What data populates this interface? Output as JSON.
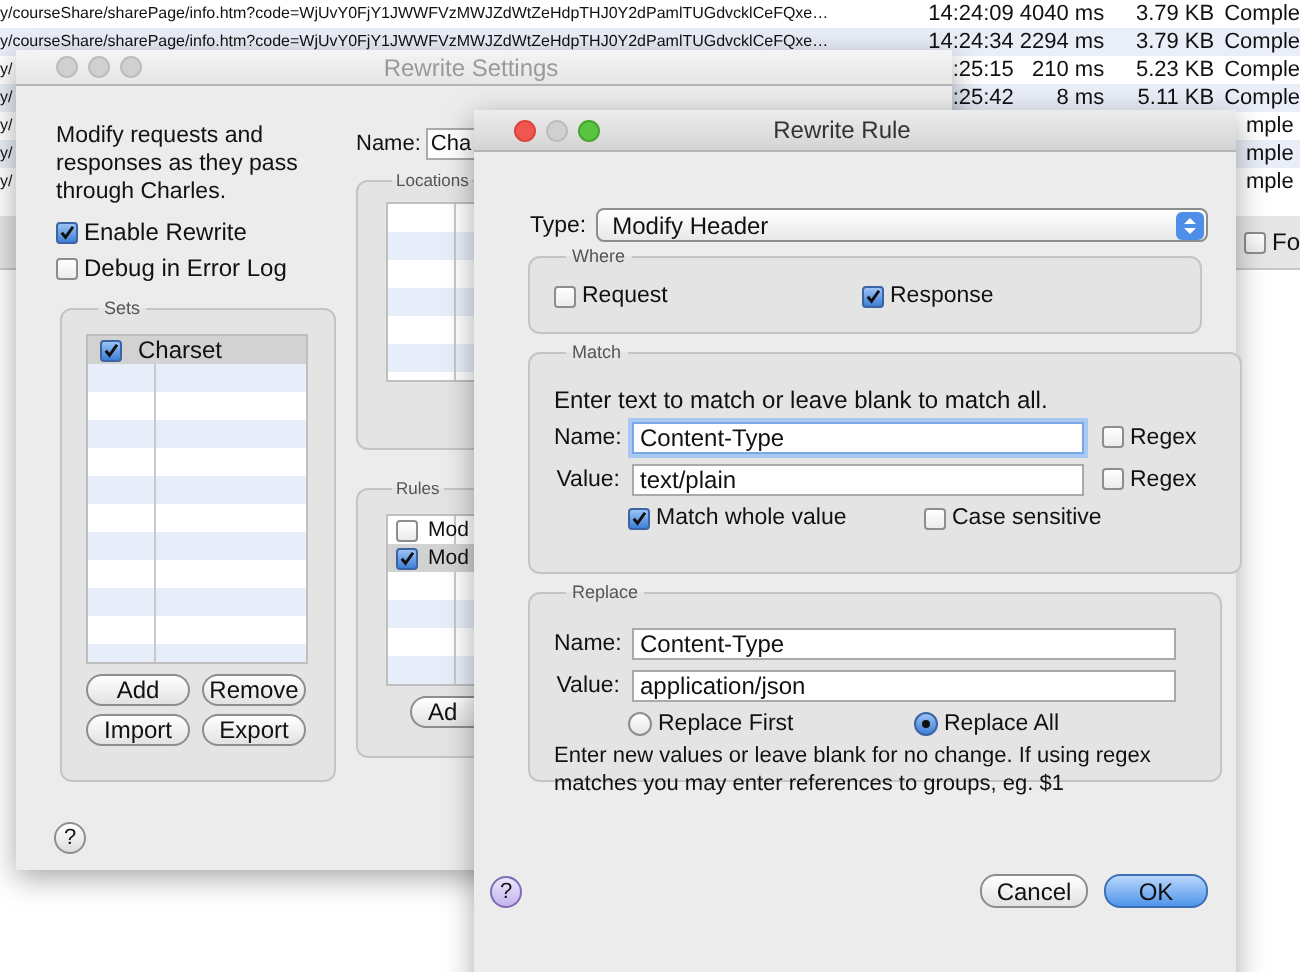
{
  "background_table": {
    "rows": [
      {
        "url": "y/courseShare/sharePage/info.htm?code=WjUvY0FjY1JWWFVzMWJZdWtZeHdpTHJ0Y2dPamlTUGdvcklCeFQxe…",
        "time": "14:24:09",
        "duration": "4040 ms",
        "size": "3.79 KB",
        "status": "Comple"
      },
      {
        "url": "y/courseShare/sharePage/info.htm?code=WjUvY0FjY1JWWFVzMWJZdWtZeHdpTHJ0Y2dPamlTUGdvcklCeFQxe…",
        "time": "14:24:34",
        "duration": "2294 ms",
        "size": "3.79 KB",
        "status": "Comple"
      },
      {
        "url": "y/",
        "time": ":25:15",
        "duration": "210 ms",
        "size": "5.23 KB",
        "status": "Comple"
      },
      {
        "url": "y/",
        "time": ":25:42",
        "duration": "8 ms",
        "size": "5.11 KB",
        "status": "Comple"
      },
      {
        "url": "y/",
        "status": "mple"
      },
      {
        "url": "y/",
        "status": "mple"
      },
      {
        "url": "y/",
        "status": "mple"
      }
    ]
  },
  "filter_checkbox": {
    "label": "Fo",
    "checked": false
  },
  "rewrite_settings": {
    "title": "Rewrite Settings",
    "description": "Modify requests and responses as they pass through Charles.",
    "enable_rewrite": {
      "label": "Enable Rewrite",
      "checked": true
    },
    "debug_log": {
      "label": "Debug in Error Log",
      "checked": false
    },
    "sets": {
      "title": "Sets",
      "items": [
        {
          "label": "Charset",
          "checked": true,
          "selected": true
        }
      ],
      "buttons": [
        "Add",
        "Remove",
        "Import",
        "Export"
      ]
    },
    "name_label": "Name:",
    "name_value": "Cha",
    "locations": {
      "title": "Locations"
    },
    "rules": {
      "title": "Rules",
      "items": [
        {
          "label": "Mod",
          "checked": false,
          "selected": false
        },
        {
          "label": "Mod",
          "checked": true,
          "selected": true
        }
      ],
      "buttons": [
        "Ad"
      ]
    },
    "help": "?"
  },
  "rewrite_rule": {
    "title": "Rewrite Rule",
    "type_label": "Type:",
    "type_value": "Modify Header",
    "where": {
      "title": "Where",
      "options": [
        {
          "label": "Request",
          "checked": false
        },
        {
          "label": "Response",
          "checked": true
        }
      ]
    },
    "match": {
      "title": "Match",
      "hint": "Enter text to match or leave blank to match all.",
      "fields": [
        {
          "label": "Name:",
          "value": "Content-Type",
          "focused": true,
          "regex": {
            "label": "Regex",
            "checked": false
          }
        },
        {
          "label": "Value:",
          "value": "text/plain",
          "focused": false,
          "regex": {
            "label": "Regex",
            "checked": false
          }
        }
      ],
      "options": [
        {
          "label": "Match whole value",
          "checked": true
        },
        {
          "label": "Case sensitive",
          "checked": false
        }
      ]
    },
    "replace": {
      "title": "Replace",
      "fields": [
        {
          "label": "Name:",
          "value": "Content-Type"
        },
        {
          "label": "Value:",
          "value": "application/json"
        }
      ],
      "options": [
        {
          "label": "Replace First",
          "selected": false
        },
        {
          "label": "Replace All",
          "selected": true
        }
      ],
      "note": "Enter new values or leave blank for no change. If using regex matches you may enter references to groups, eg. $1"
    },
    "help": "?",
    "buttons": [
      {
        "label": "Cancel",
        "kind": "secondary"
      },
      {
        "label": "OK",
        "kind": "primary"
      }
    ]
  }
}
